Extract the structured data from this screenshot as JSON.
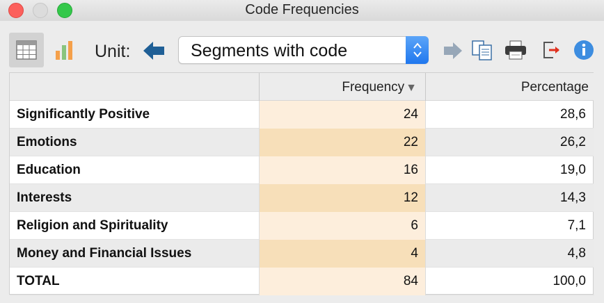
{
  "window": {
    "title": "Code Frequencies"
  },
  "toolbar": {
    "unit_label": "Unit:",
    "unit_select": {
      "value": "Segments with code"
    },
    "icons": [
      "table-view-icon",
      "chart-view-icon",
      "arrow-left-icon",
      "arrow-right-icon",
      "copy-icon",
      "print-icon",
      "export-icon",
      "info-icon"
    ]
  },
  "table": {
    "columns": [
      "",
      "Frequency",
      "Percentage"
    ],
    "sort": {
      "column": "Frequency",
      "direction": "descending"
    },
    "rows": [
      {
        "code": "Significantly Positive",
        "frequency": "24",
        "percentage": "28,6"
      },
      {
        "code": "Emotions",
        "frequency": "22",
        "percentage": "26,2"
      },
      {
        "code": "Education",
        "frequency": "16",
        "percentage": "19,0"
      },
      {
        "code": "Interests",
        "frequency": "12",
        "percentage": "14,3"
      },
      {
        "code": "Religion and Spirituality",
        "frequency": "6",
        "percentage": "7,1"
      },
      {
        "code": "Money and Financial Issues",
        "frequency": "4",
        "percentage": "4,8"
      },
      {
        "code": "TOTAL",
        "frequency": "84",
        "percentage": "100,0"
      }
    ]
  },
  "colors": {
    "freq_light": "#fdeedc",
    "freq_dark": "#f7dfb9",
    "accent_blue": "#2f80ed",
    "close": "#fc605c",
    "maximize": "#34c84a"
  }
}
